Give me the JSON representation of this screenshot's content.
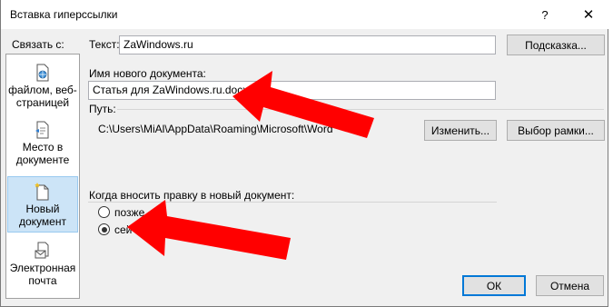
{
  "dialog": {
    "title": "Вставка гиперссылки",
    "help_glyph": "?",
    "close_glyph": "✕"
  },
  "link_with": {
    "label": "Связать с:",
    "items": [
      {
        "label_line1": "файлом, веб-",
        "label_line2": "страницей",
        "icon": "web-page-icon",
        "selected": false
      },
      {
        "label_line1": "Место в",
        "label_line2": "документе",
        "icon": "place-in-document-icon",
        "selected": false
      },
      {
        "label_line1": "Новый",
        "label_line2": "документ",
        "icon": "new-document-icon",
        "selected": true
      },
      {
        "label_line1": "Электронная",
        "label_line2": "почта",
        "icon": "email-icon",
        "selected": false
      }
    ]
  },
  "text_field": {
    "label": "Текст:",
    "value": "ZaWindows.ru"
  },
  "tooltip_button": "Подсказка...",
  "new_doc_name": {
    "label": "Имя нового документа:",
    "value": "Статья для ZaWindows.ru.docx"
  },
  "path": {
    "label": "Путь:",
    "value": "C:\\Users\\MiAl\\AppData\\Roaming\\Microsoft\\Word\\"
  },
  "change_button": "Изменить...",
  "frame_button": "Выбор рамки...",
  "edit_when": {
    "label": "Когда вносить правку в новый документ:",
    "options": [
      {
        "label": "позже",
        "checked": false
      },
      {
        "label": "сейчас",
        "checked": true
      }
    ]
  },
  "ok_button": "ОК",
  "cancel_button": "Отмена",
  "colors": {
    "annotation_arrow": "#ff0000",
    "selected_bg": "#cce4f7",
    "default_button_border": "#0078d7"
  }
}
